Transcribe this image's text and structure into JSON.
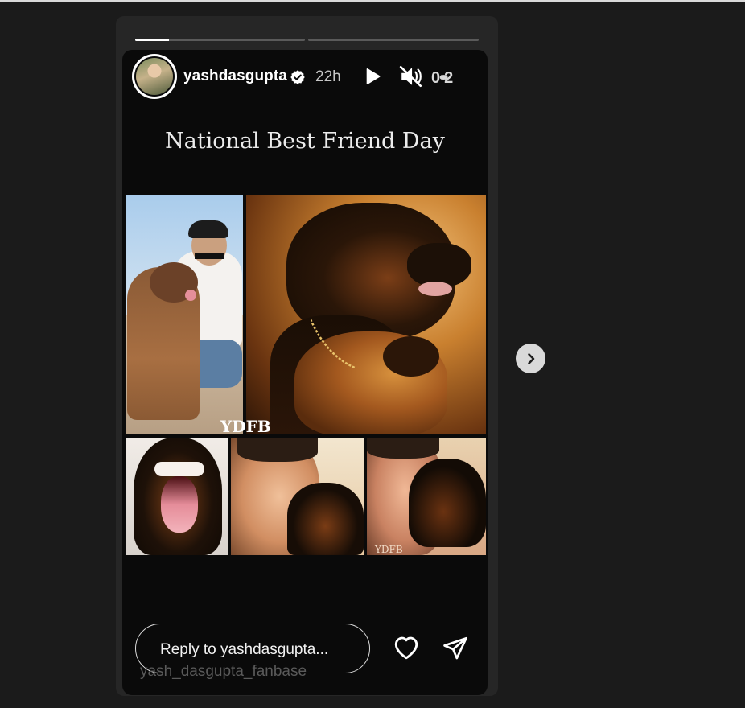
{
  "story": {
    "progress_segments": [
      0.2,
      0.0
    ],
    "username": "yashdasgupta",
    "verified": true,
    "time": "22h",
    "more_label": "0••••••••••••••••••••••••••••••••••••••••••••••••••••••••••••••••••••••••••••••••••••••••••••••••••",
    "title": "National Best Friend Day",
    "watermark_large": "YDFB",
    "watermark_small": "YDFB",
    "reply_placeholder": "Reply to yashdasgupta...",
    "caption_user": "yash_dasgupta_fanbase"
  },
  "icons": {
    "play": "play-icon",
    "mute": "muted-speaker-icon",
    "more": "more-options-icon",
    "like": "heart-icon",
    "share": "paper-plane-icon",
    "next": "chevron-right-icon"
  },
  "colors": {
    "background": "#1b1b1b",
    "card": "#0a0a0a",
    "frame": "#262626",
    "text": "#ffffff",
    "muted_text": "#c8c8c8"
  }
}
